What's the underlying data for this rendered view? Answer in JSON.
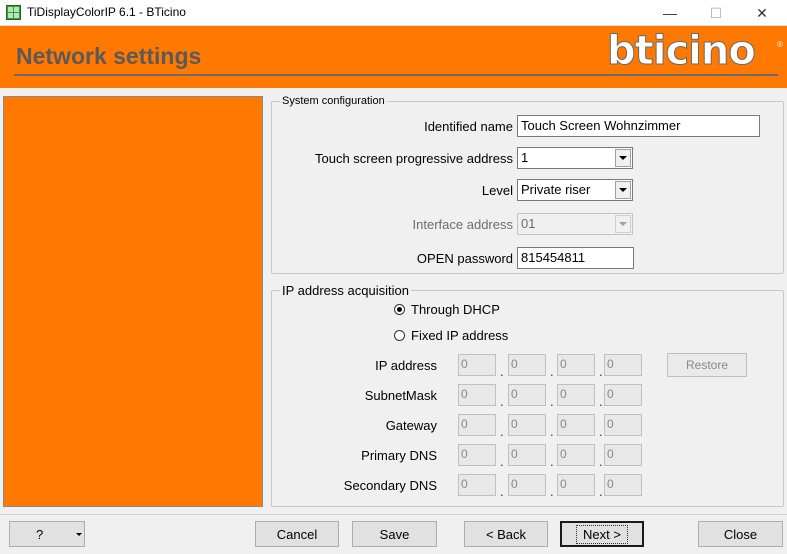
{
  "window": {
    "title": "TiDisplayColorIP 6.1 - BTicino",
    "minimize_glyph": "—",
    "maximize_glyph": "☐",
    "close_glyph": "✕"
  },
  "header": {
    "title": "Network settings",
    "brand": "bticino",
    "brand_mark": "®",
    "banner_color": "#ff7900"
  },
  "system_config": {
    "legend": "System configuration",
    "identified_name_label": "Identified name",
    "identified_name_value": "Touch Screen Wohnzimmer",
    "progressive_address_label": "Touch screen progressive address",
    "progressive_address_value": "1",
    "level_label": "Level",
    "level_value": "Private riser",
    "interface_address_label": "Interface address",
    "interface_address_value": "01",
    "open_password_label": "OPEN password",
    "open_password_value": "815454811"
  },
  "ip_acquisition": {
    "legend": "IP address acquisition",
    "dhcp_label": "Through DHCP",
    "fixed_label": "Fixed IP address",
    "selected": "dhcp",
    "restore_label": "Restore",
    "rows": [
      {
        "label": "IP address",
        "octets": [
          "0",
          "0",
          "0",
          "0"
        ]
      },
      {
        "label": "SubnetMask",
        "octets": [
          "0",
          "0",
          "0",
          "0"
        ]
      },
      {
        "label": "Gateway",
        "octets": [
          "0",
          "0",
          "0",
          "0"
        ]
      },
      {
        "label": "Primary DNS",
        "octets": [
          "0",
          "0",
          "0",
          "0"
        ]
      },
      {
        "label": "Secondary DNS",
        "octets": [
          "0",
          "0",
          "0",
          "0"
        ]
      }
    ]
  },
  "footer": {
    "help_label": "?",
    "cancel_label": "Cancel",
    "save_label": "Save",
    "back_label": "< Back",
    "next_label": "Next >",
    "close_label": "Close"
  }
}
